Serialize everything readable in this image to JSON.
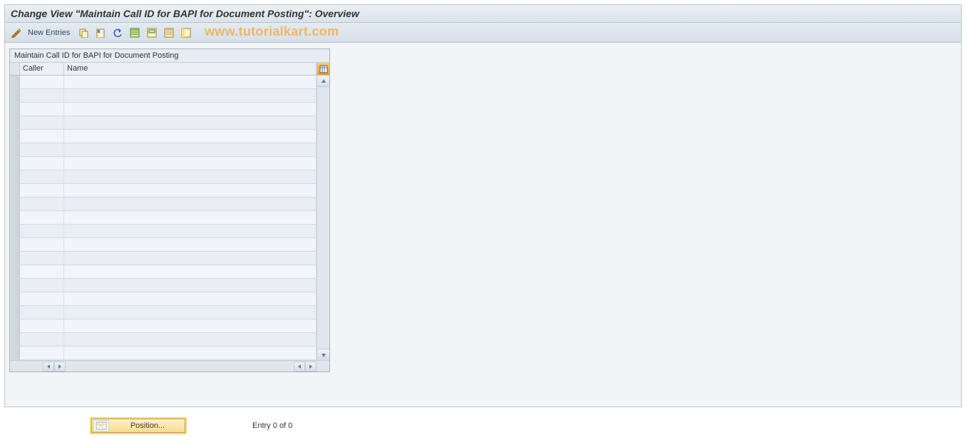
{
  "window": {
    "title": "Change View \"Maintain Call ID for BAPI for Document Posting\": Overview"
  },
  "toolbar": {
    "new_entries_label": "New Entries"
  },
  "watermark": "www.tutorialkart.com",
  "grid": {
    "title": "Maintain Call ID for BAPI for Document Posting",
    "columns": {
      "caller": "Caller",
      "name": "Name"
    },
    "row_count": 21,
    "rows": []
  },
  "footer": {
    "position_label": "Position...",
    "entry_text": "Entry 0 of 0"
  }
}
